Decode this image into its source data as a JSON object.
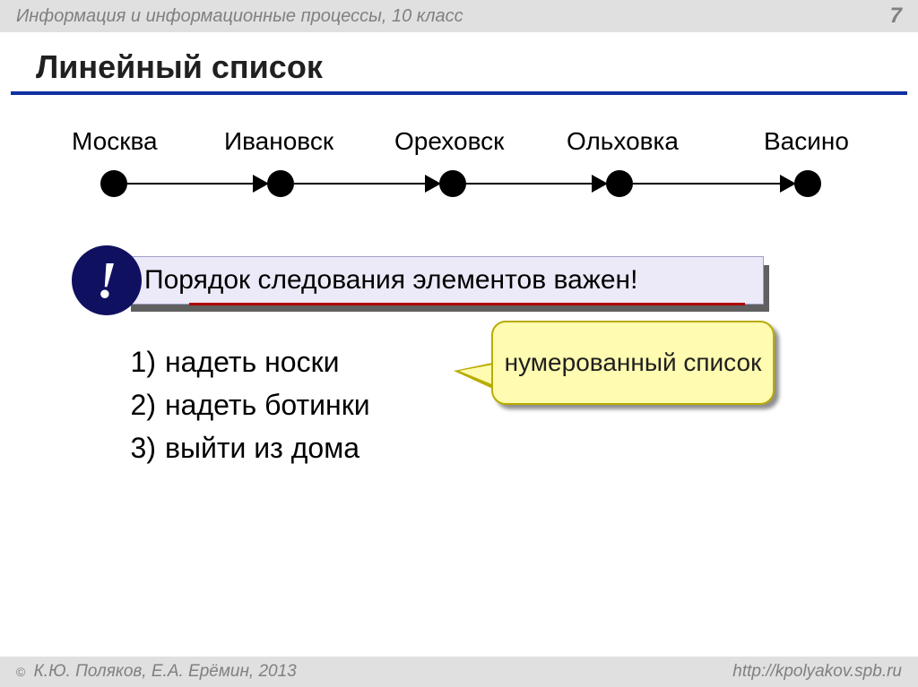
{
  "header": {
    "subject": "Информация и информационные процессы, 10 класс",
    "page": "7"
  },
  "title": "Линейный список",
  "nodes": [
    "Москва",
    "Ивановск",
    "Ореховск",
    "Ольховка",
    "Васино"
  ],
  "callout": {
    "bang": "!",
    "text": "Порядок следования элементов важен!"
  },
  "list": {
    "items": [
      {
        "n": "1)",
        "text": "надеть носки"
      },
      {
        "n": "2)",
        "text": "надеть ботинки"
      },
      {
        "n": "3)",
        "text": "выйти из дома"
      }
    ]
  },
  "note": "нумерованный список",
  "footer": {
    "copyright_symbol": "©",
    "authors": " К.Ю. Поляков, Е.А. Ерёмин, 2013",
    "url": "http://kpolyakov.spb.ru"
  }
}
